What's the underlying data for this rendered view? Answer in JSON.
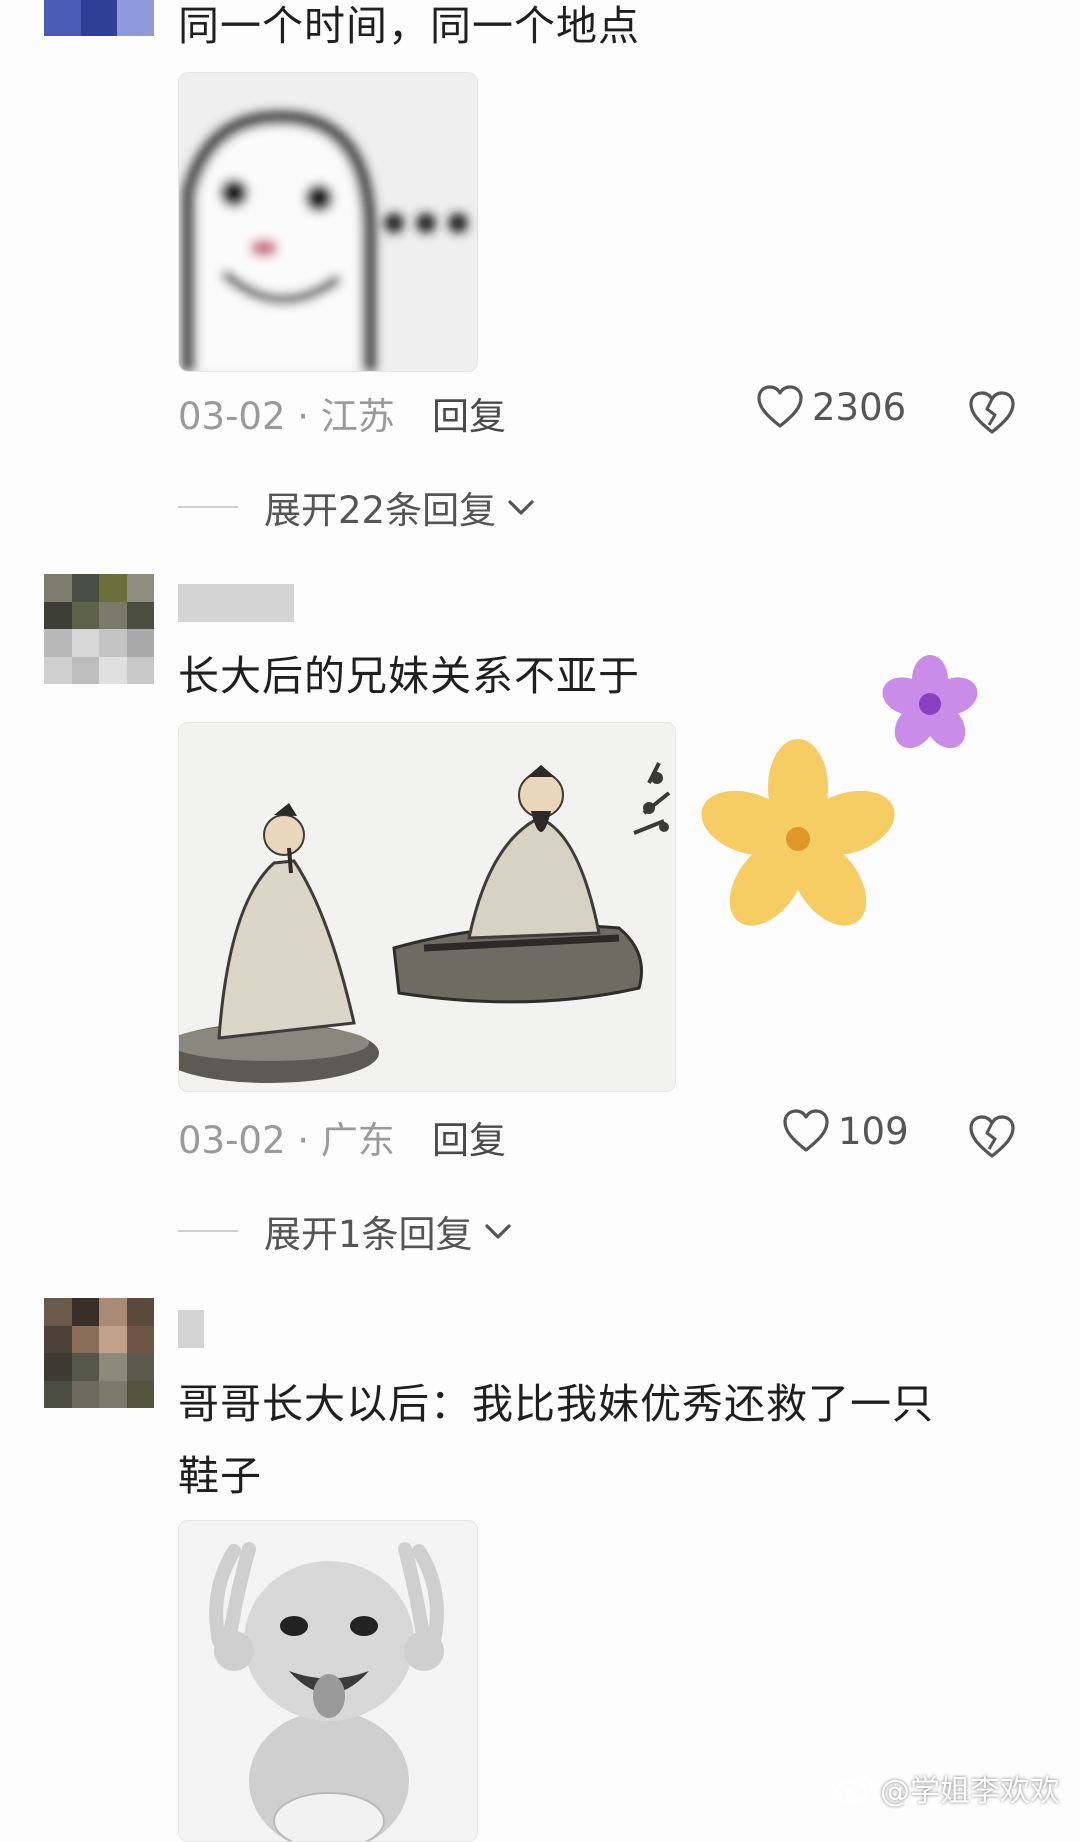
{
  "comments": [
    {
      "text_lines": [
        "同一个时间，同一个地点"
      ],
      "date": "03-02",
      "location": "江苏",
      "reply_label": "回复",
      "likes": "2306",
      "expand_label": "展开22条回复"
    },
    {
      "text_lines": [
        "长大后的兄妹关系不亚于"
      ],
      "date": "03-02",
      "location": "广东",
      "reply_label": "回复",
      "likes": "109",
      "expand_label": "展开1条回复"
    },
    {
      "text_lines": [
        "哥哥长大以后：我比我妹优秀还救了一只",
        "鞋子"
      ]
    }
  ],
  "meta_separator": " · ",
  "watermark": "@学姐李欢欢",
  "icons": {
    "like": "heart-outline-icon",
    "dislike": "broken-heart-icon",
    "expand": "chevron-down-icon",
    "watermark": "weibo-logo-icon"
  },
  "colors": {
    "text": "#1f1f1f",
    "meta": "#9a9a9a",
    "flower_yellow": "#f6cd62",
    "flower_purple": "#c98de8"
  }
}
